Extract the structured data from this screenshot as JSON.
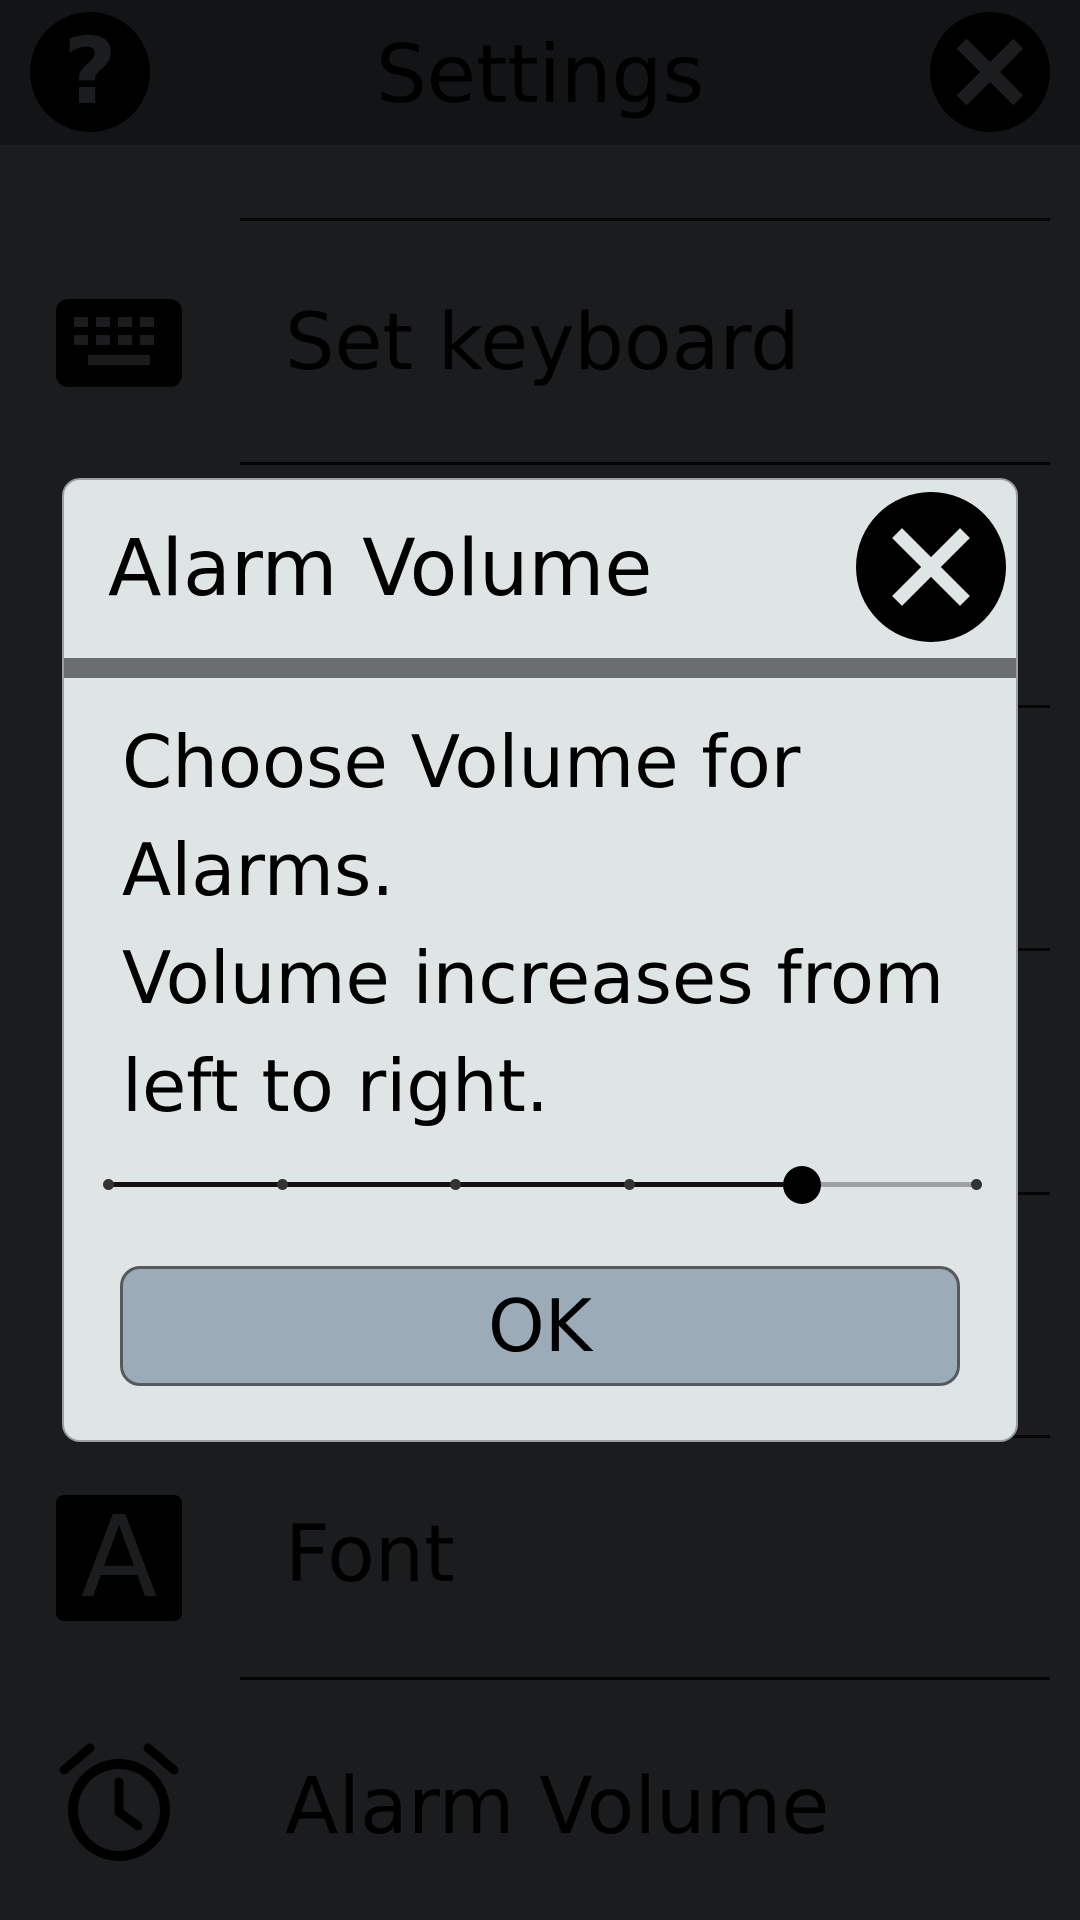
{
  "header": {
    "title": "Settings",
    "help_icon": "help-icon",
    "close_icon": "close-icon"
  },
  "settings_items": [
    {
      "label": "Set keyboard",
      "icon": "keyboard-icon"
    },
    {
      "label": "Font",
      "icon": "font-icon",
      "icon_glyph": "A"
    },
    {
      "label": "Alarm Volume",
      "icon": "alarm-clock-icon"
    }
  ],
  "dialog": {
    "title": "Alarm Volume",
    "close_icon": "close-icon",
    "message_line1": "Choose Volume for Alarms.",
    "message_line2": "Volume increases from left to right.",
    "ok_label": "OK",
    "volume": {
      "steps": 6,
      "selected_index": 4
    }
  },
  "colors": {
    "dialog_bg": "#dfe4e5",
    "button_bg": "#9bacb8",
    "overlay_bg": "#1a1c1e"
  }
}
